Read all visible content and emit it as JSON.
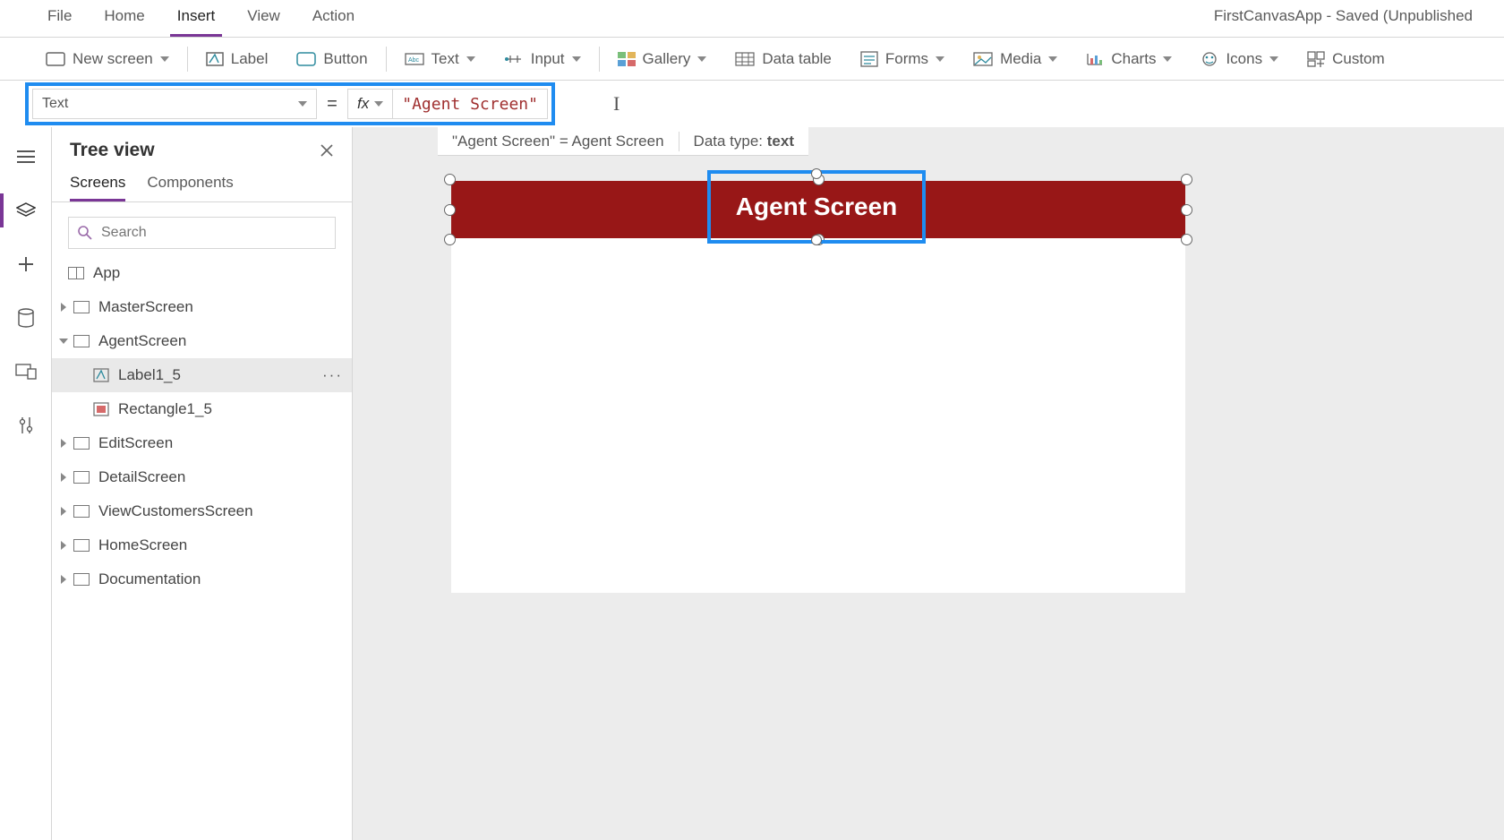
{
  "app": {
    "title": "FirstCanvasApp - Saved (Unpublished"
  },
  "menu": {
    "file": "File",
    "home": "Home",
    "insert": "Insert",
    "view": "View",
    "action": "Action"
  },
  "ribbon": {
    "newscreen": "New screen",
    "label": "Label",
    "button": "Button",
    "text": "Text",
    "input": "Input",
    "gallery": "Gallery",
    "datatable": "Data table",
    "forms": "Forms",
    "media": "Media",
    "charts": "Charts",
    "icons": "Icons",
    "custom": "Custom"
  },
  "formula": {
    "property": "Text",
    "eq": "=",
    "fx": "fx",
    "value": "\"Agent Screen\"",
    "result_left": "\"Agent Screen\"",
    "result_eq": " = ",
    "result_right": "Agent Screen",
    "datatype_label": "Data type: ",
    "datatype_value": "text"
  },
  "tree": {
    "title": "Tree view",
    "tab_screens": "Screens",
    "tab_components": "Components",
    "search_placeholder": "Search",
    "app": "App",
    "items": [
      {
        "label": "MasterScreen"
      },
      {
        "label": "AgentScreen"
      },
      {
        "label": "Label1_5"
      },
      {
        "label": "Rectangle1_5"
      },
      {
        "label": "EditScreen"
      },
      {
        "label": "DetailScreen"
      },
      {
        "label": "ViewCustomersScreen"
      },
      {
        "label": "HomeScreen"
      },
      {
        "label": "Documentation"
      }
    ]
  },
  "canvas": {
    "label_text": "Agent Screen"
  }
}
